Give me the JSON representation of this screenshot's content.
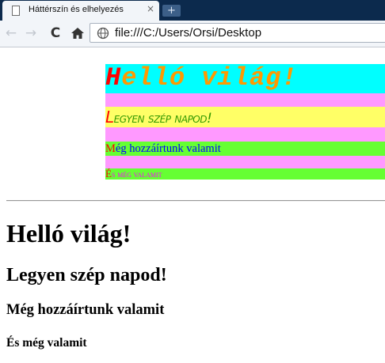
{
  "browser": {
    "tab": {
      "title": "Háttérszín és elhelyezés",
      "close_label": "×"
    },
    "new_tab_label": "+",
    "nav": {
      "back_label": "←",
      "forward_label": "→",
      "reload_label": "C"
    },
    "address_bar": {
      "url": "file:///C:/Users/Orsi/Desktop"
    }
  },
  "page": {
    "bands": [
      {
        "first": "H",
        "rest": "elló világ!"
      },
      {
        "first": "L",
        "rest": "egyen szép napod!"
      },
      {
        "first": "M",
        "rest": "ég hozzáírtunk valamit"
      },
      {
        "first": "É",
        "rest": "s még valamit"
      }
    ],
    "headings": {
      "h1": "Helló világ!",
      "h2": "Legyen szép napod!",
      "h3": "Még hozzáírtunk valamit",
      "h4": "És még valamit"
    }
  },
  "colors": {
    "tabbar_bg": "#0c2a4d",
    "toolbar_bg": "#f2f5f9",
    "band1_bg": "#00ffff",
    "band1_text": "#ff9900",
    "separator_bg": "#ff99ff",
    "band2_bg": "#ffff66",
    "band2_text": "#339900",
    "band3_bg": "#66ff33",
    "band3_text": "#0000ff",
    "band4_text": "#ff00ff",
    "first_letter": "#ff0000"
  },
  "icons": {
    "tab": "page-icon",
    "back": "arrow-left-icon",
    "forward": "arrow-right-icon",
    "reload": "reload-icon",
    "home": "home-icon",
    "address": "globe-icon"
  }
}
